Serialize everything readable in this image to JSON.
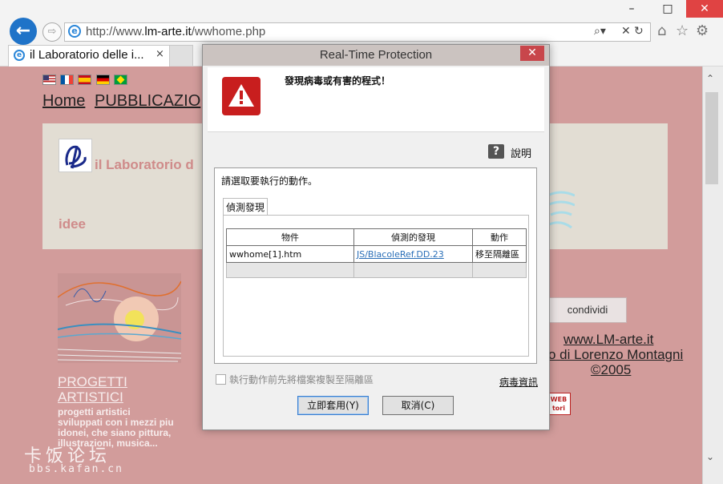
{
  "browser": {
    "url_prefix": "http://www.",
    "url_domain": "lm-arte.it",
    "url_path": "/wwhome.php",
    "tab_title": "il Laboratorio delle i...",
    "tab_close": "×",
    "back_glyph": "←",
    "forward_glyph": "⇨",
    "window_controls": [
      "–",
      "□",
      "✕"
    ],
    "addr_icons": [
      "⌕▾",
      "✕",
      "↻"
    ],
    "toolbar_icons": [
      "home-icon",
      "favorites-star-icon",
      "settings-gear-icon"
    ]
  },
  "page": {
    "nav_home": "Home",
    "nav_pub": "PUBBLICAZIO",
    "banner_title": "il Laboratorio d",
    "banner_sub": "idee",
    "projects_title": "PROGETTI ARTISTICI",
    "projects_desc": "progetti artistici sviluppati con i mezzi piu idonei, che siano pittura, illustrazioni, musica...",
    "share_label": "condividi",
    "site_url": "www.LM-arte.it",
    "site_author": "o di Lorenzo Montagni",
    "site_year": "©2005",
    "badge_text": "WEB\ntori",
    "watermark": "卡饭论坛",
    "watermark_sub": "bbs.kafan.cn",
    "flags": [
      "us",
      "fr",
      "es",
      "de",
      "br"
    ]
  },
  "dialog": {
    "title": "Real-Time Protection",
    "close_glyph": "✕",
    "warning_message": "發現病毒或有害的程式！",
    "help_icon_glyph": "?",
    "help_label": "說明",
    "action_prompt": "請選取要執行的動作。",
    "tab_label": "偵測發現",
    "table": {
      "headers": [
        "物件",
        "偵測的發現",
        "動作"
      ],
      "rows": [
        [
          "wwhome[1].htm",
          "JS/BlacoleRef.DD.23",
          "移至隔離區"
        ]
      ]
    },
    "checkbox_label": "執行動作前先將檔案複製至隔離區",
    "virus_info_link": "病毒資訊",
    "apply_button": "立即套用(Y)",
    "cancel_button": "取消(C)"
  },
  "colors": {
    "page_bg": "#d29c9b",
    "banner_bg": "#e2ddd3",
    "accent_blue": "#1f73c8",
    "warning_red": "#c81e1e"
  }
}
